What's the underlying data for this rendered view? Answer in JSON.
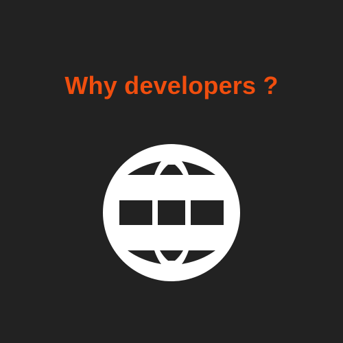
{
  "title": "Why developers ?",
  "icon": "globe-icon",
  "colors": {
    "background": "#222222",
    "title": "#f04e0e",
    "icon": "#ffffff"
  }
}
